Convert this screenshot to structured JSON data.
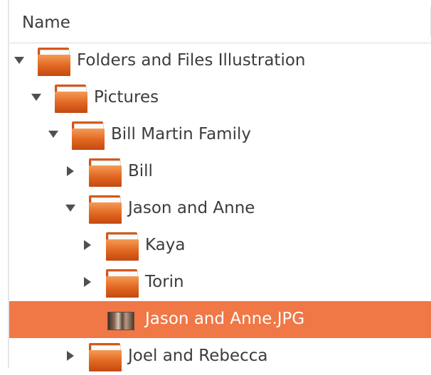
{
  "header": {
    "column_name": "Name"
  },
  "colors": {
    "selection": "#f07746",
    "folder": "#e0651f",
    "text": "#3c3c3c"
  },
  "tree": {
    "rows": [
      {
        "label": "Folders and Files Illustration",
        "expander": "expanded",
        "icon": "folder-icon"
      },
      {
        "label": "Pictures",
        "expander": "expanded",
        "icon": "folder-icon"
      },
      {
        "label": "Bill Martin Family",
        "expander": "expanded",
        "icon": "folder-icon"
      },
      {
        "label": "Bill",
        "expander": "collapsed",
        "icon": "folder-icon"
      },
      {
        "label": "Jason and Anne",
        "expander": "expanded",
        "icon": "folder-icon"
      },
      {
        "label": "Kaya",
        "expander": "collapsed",
        "icon": "folder-icon"
      },
      {
        "label": "Torin",
        "expander": "collapsed",
        "icon": "folder-icon"
      },
      {
        "label": "Jason and Anne.JPG",
        "expander": "none",
        "icon": "image-thumbnail-icon",
        "selected": true
      },
      {
        "label": "Joel and Rebecca",
        "expander": "collapsed",
        "icon": "folder-icon"
      }
    ]
  }
}
